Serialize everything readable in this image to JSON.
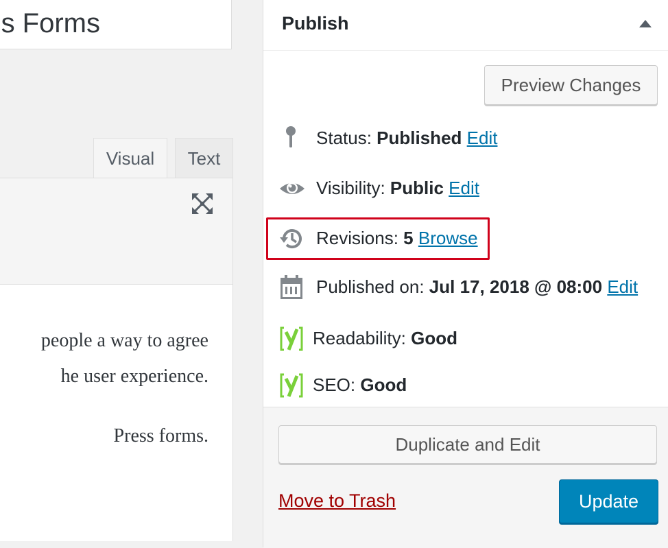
{
  "editor": {
    "title_fragment": "s Forms",
    "tabs": {
      "visual": "Visual",
      "text": "Text"
    },
    "paragraphs": [
      "people a way to agree",
      "he user experience.",
      "Press forms."
    ]
  },
  "publish": {
    "title": "Publish",
    "preview_label": "Preview Changes",
    "status": {
      "label": "Status:",
      "value": "Published",
      "action": "Edit"
    },
    "visibility": {
      "label": "Visibility:",
      "value": "Public",
      "action": "Edit"
    },
    "revisions": {
      "label": "Revisions:",
      "value": "5",
      "action": "Browse"
    },
    "published_on": {
      "label": "Published on:",
      "value": "Jul 17, 2018 @ 08:00",
      "action": "Edit"
    },
    "readability": {
      "label": "Readability:",
      "value": "Good"
    },
    "seo": {
      "label": "SEO:",
      "value": "Good"
    },
    "duplicate_label": "Duplicate and Edit",
    "trash_label": "Move to Trash",
    "update_label": "Update"
  },
  "colors": {
    "link": "#0073aa",
    "trash": "#a00000",
    "primary_button": "#0085ba",
    "yoast_green": "#7ad03a",
    "highlight": "#d0021b"
  }
}
